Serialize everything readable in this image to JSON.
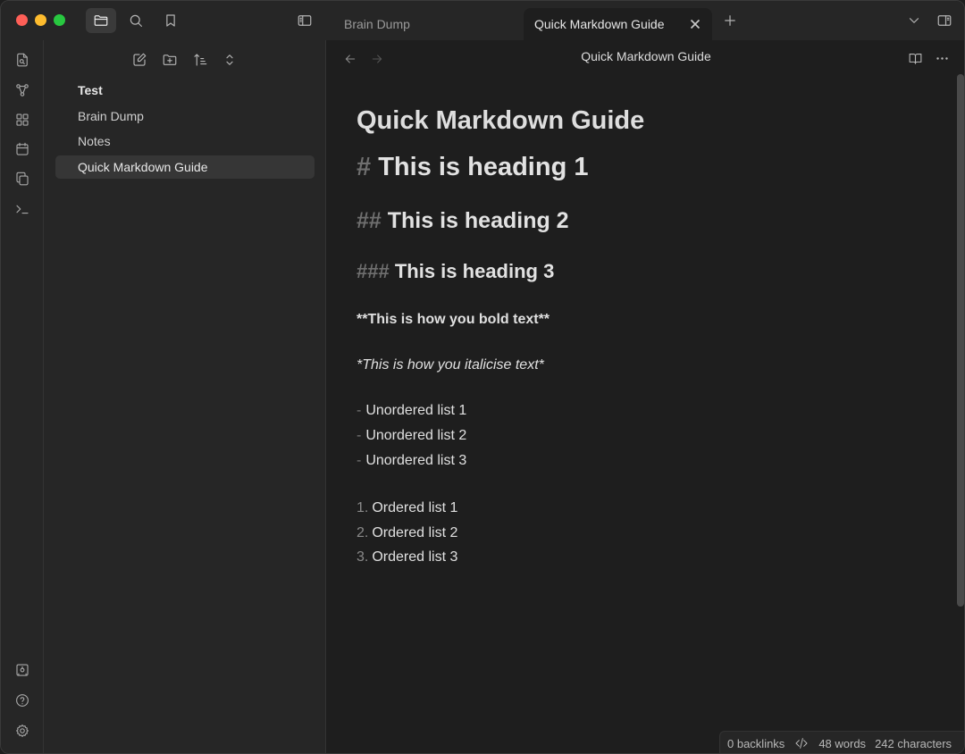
{
  "window": {
    "tabs": [
      {
        "label": "Brain Dump",
        "active": false
      },
      {
        "label": "Quick Markdown Guide",
        "active": true
      }
    ]
  },
  "sidebar": {
    "root": "Test",
    "items": [
      {
        "label": "Brain Dump"
      },
      {
        "label": "Notes"
      },
      {
        "label": "Quick Markdown Guide",
        "active": true
      }
    ]
  },
  "view": {
    "title": "Quick Markdown Guide"
  },
  "document": {
    "title": "Quick Markdown Guide",
    "h1": {
      "mark": "#",
      "text": "This is heading 1"
    },
    "h2": {
      "mark": "##",
      "text": "This is heading 2"
    },
    "h3": {
      "mark": "###",
      "text": "This is heading 3"
    },
    "bold": "**This is how you bold text**",
    "italic": "*This is how you italicise text*",
    "unordered": [
      {
        "marker": "-",
        "text": "Unordered list 1"
      },
      {
        "marker": "-",
        "text": "Unordered list 2"
      },
      {
        "marker": "-",
        "text": "Unordered list 3"
      }
    ],
    "ordered": [
      {
        "marker": "1.",
        "text": "Ordered list 1"
      },
      {
        "marker": "2.",
        "text": "Ordered list 2"
      },
      {
        "marker": "3.",
        "text": "Ordered list 3"
      }
    ]
  },
  "status": {
    "backlinks": "0 backlinks",
    "words": "48 words",
    "characters": "242 characters"
  },
  "colors": {
    "background": "#1e1e1e",
    "panel": "#262626",
    "active_item": "#363636",
    "close_red": "#fe5f57",
    "minimize_yellow": "#febc2e",
    "zoom_green": "#28c840"
  }
}
